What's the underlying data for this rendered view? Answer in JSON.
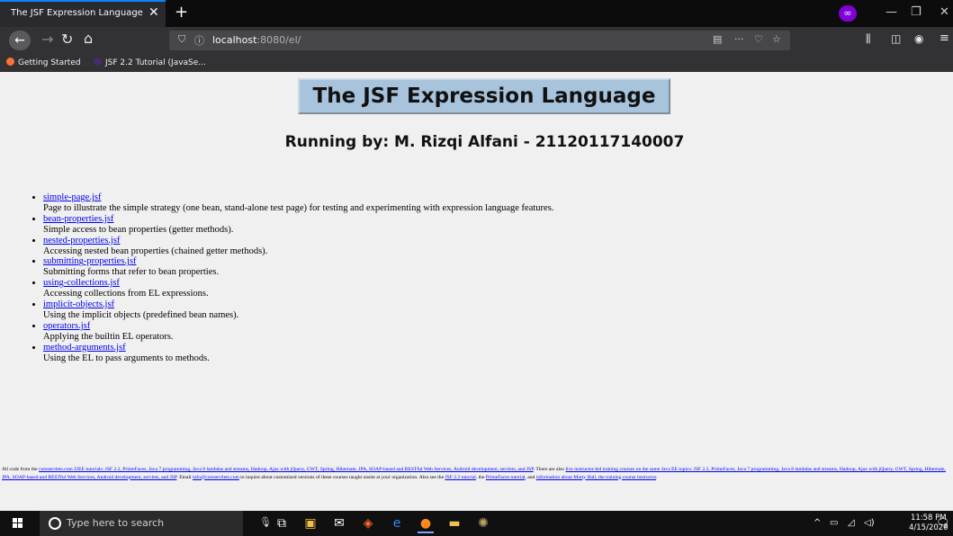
{
  "browser": {
    "tab_title": "The JSF Expression Language",
    "tab_close": "✕",
    "new_tab": "+",
    "url_host": "localhost",
    "url_path": ":8080/el/",
    "bookmarks": [
      "Getting Started",
      "JSF 2.2 Tutorial (JavaSe..."
    ]
  },
  "page": {
    "title": "The JSF Expression Language",
    "subtitle": "Running by: M. Rizqi Alfani - 21120117140007",
    "items": [
      {
        "link": "simple-page.jsf",
        "desc": "Page to illustrate the simple strategy (one bean, stand-alone test page) for testing and experimenting with expression language features."
      },
      {
        "link": "bean-properties.jsf",
        "desc": "Simple access to bean properties (getter methods)."
      },
      {
        "link": "nested-properties.jsf",
        "desc": "Accessing nested bean properties (chained getter methods)."
      },
      {
        "link": "submitting-properties.jsf",
        "desc": "Submitting forms that refer to bean properties."
      },
      {
        "link": "using-collections.jsf",
        "desc": "Accessing collections from EL expressions."
      },
      {
        "link": "implicit-objects.jsf",
        "desc": "Using the implicit objects (predefined bean names)."
      },
      {
        "link": "operators.jsf",
        "desc": "Applying the builtin EL operators."
      },
      {
        "link": "method-arguments.jsf",
        "desc": "Using the EL to pass arguments to methods."
      }
    ],
    "footer": {
      "t1": "All code from the ",
      "l1": "coreservlets.com J2EE tutorials: JSF 2.2, PrimeFaces, Java 7 programming, Java 8 lambdas and streams, Hadoop, Ajax with jQuery, GWT, Spring, Hibernate, JPA, SOAP-based and RESTful Web Services, Android development, servlets, and JSP",
      "t2": ". There are also ",
      "l2": "live instructor-led training courses on the same Java EE topics: JSF 2.2, PrimeFaces, Java 7 programming, Java 8 lambdas and streams, Hadoop, Ajax with jQuery, GWT, Spring, Hibernate, JPA, SOAP-based and RESTful Web Services, Android development, servlets, and JSP",
      "t3": ". Email ",
      "l3": "info@coreservlets.com",
      "t4": " to inquire about customized versions of these courses taught onsite at ",
      "t4i": "your",
      "t5": " organization. Also see the ",
      "l4": "JSF 2.2 tutorial",
      "t6": ", the ",
      "l5": "PrimeFaces tutorial",
      "t7": ", and ",
      "l6": "information about Marty Hall, the training course instructor",
      "t8": "."
    }
  },
  "taskbar": {
    "search_placeholder": "Type here to search",
    "time": "11:58 PM",
    "date": "4/15/2020",
    "notif_count": "2"
  }
}
